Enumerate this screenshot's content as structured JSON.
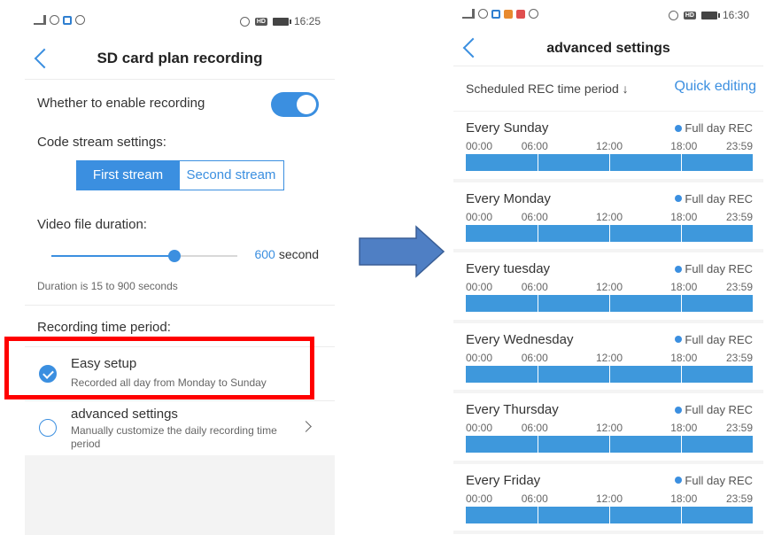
{
  "left": {
    "title": "SD card plan recording",
    "time": "16:25",
    "enable_label": "Whether to enable recording",
    "enable_on": true,
    "code_stream_label": "Code stream settings:",
    "streams": [
      "First stream",
      "Second stream"
    ],
    "selected_stream": "First stream",
    "duration_label": "Video file duration:",
    "duration_value": "600",
    "duration_unit": "second",
    "duration_min": 15,
    "duration_max": 900,
    "duration_hint": "Duration is 15 to 900 seconds",
    "recording_period_label": "Recording time period:",
    "options": [
      {
        "title": "Easy setup",
        "desc": "Recorded all day from Monday to Sunday",
        "checked": true
      },
      {
        "title": "advanced settings",
        "desc": "Manually customize the daily recording time period",
        "checked": false
      }
    ]
  },
  "right": {
    "title": "advanced settings",
    "time": "16:30",
    "sched_label": "Scheduled REC time period ↓",
    "quick_edit": "Quick editing",
    "tick_labels": [
      "00:00",
      "06:00",
      "12:00",
      "18:00",
      "23:59"
    ],
    "days": [
      {
        "name": "Every Sunday",
        "status": "Full day REC"
      },
      {
        "name": "Every Monday",
        "status": "Full day REC"
      },
      {
        "name": "Every tuesday",
        "status": "Full day REC"
      },
      {
        "name": "Every Wednesday",
        "status": "Full day REC"
      },
      {
        "name": "Every Thursday",
        "status": "Full day REC"
      },
      {
        "name": "Every Friday",
        "status": "Full day REC"
      }
    ]
  },
  "colors": {
    "accent": "#3b8fe0",
    "highlight": "#ff0000",
    "bar": "#3e98dc"
  }
}
